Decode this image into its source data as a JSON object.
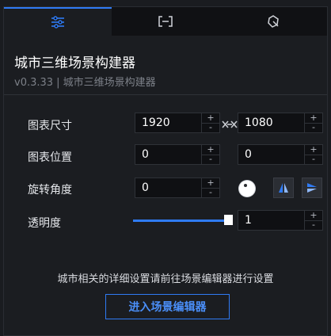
{
  "tabs": [
    {
      "id": "settings",
      "icon": "sliders-icon",
      "active": true
    },
    {
      "id": "layout",
      "icon": "bracket-frame-icon",
      "active": false
    },
    {
      "id": "interaction",
      "icon": "cursor-shape-icon",
      "active": false
    }
  ],
  "header": {
    "title": "城市三维场景构建器",
    "subtitle": "v0.3.33 | 城市三维场景构建器"
  },
  "form": {
    "size": {
      "label": "图表尺寸",
      "width": "1920",
      "height": "1080"
    },
    "position": {
      "label": "图表位置",
      "x": "0",
      "y": "0"
    },
    "rotation": {
      "label": "旋转角度",
      "value": "0"
    },
    "opacity": {
      "label": "透明度",
      "value": "1",
      "slider_level": 1
    },
    "spin": {
      "up": "+",
      "down": "-"
    }
  },
  "footer": {
    "hint": "城市相关的详细设置请前往场景编辑器进行设置",
    "button": "进入场景编辑器"
  },
  "colors": {
    "accent": "#2f7bf5",
    "background": "#1b1d21",
    "input_bg": "#0f1013"
  }
}
